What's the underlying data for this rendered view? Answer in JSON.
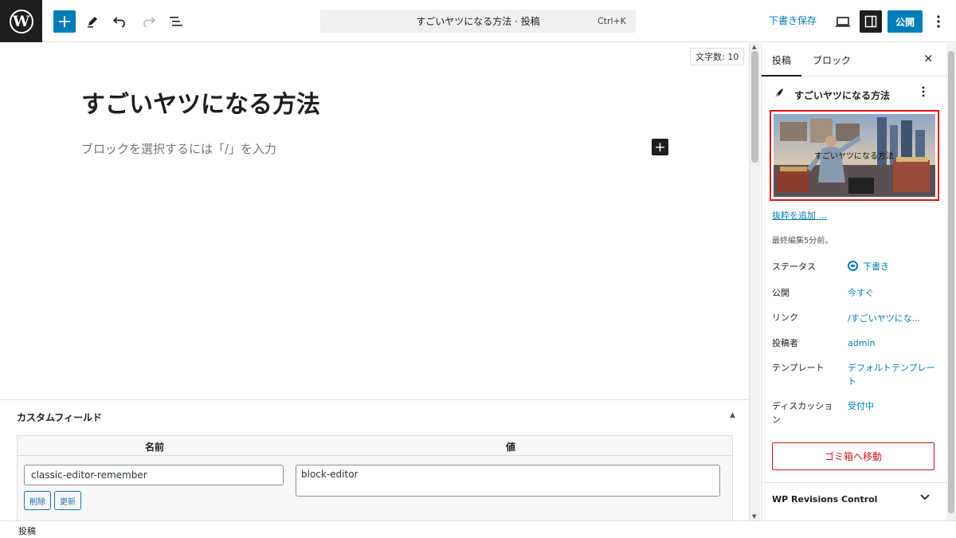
{
  "toolbar": {
    "logo_letter": "W",
    "inserter_icon": "+",
    "command_text": "すごいヤツになる方法 · 投稿",
    "command_shortcut": "Ctrl+K",
    "save_draft_label": "下書き保存",
    "publish_label": "公開"
  },
  "editor": {
    "word_count": "文字数: 10",
    "post_title": "すごいヤツになる方法",
    "block_placeholder": "ブロックを選択するには「/」を入力",
    "block_add_icon": "+"
  },
  "custom_fields": {
    "title": "カスタムフィールド",
    "col_name": "名前",
    "col_value": "値",
    "key": "classic-editor-remember",
    "value": "block-editor",
    "delete_label": "削除",
    "update_label": "更新"
  },
  "footer": {
    "breadcrumb": "投稿"
  },
  "sidebar": {
    "tab_post": "投稿",
    "tab_block": "ブロック",
    "close_icon": "×",
    "post_title": "すごいヤツになる方法",
    "image_overlay_text": "すごいヤツになる方法",
    "excerpt_link": "抜粋を追加 ...",
    "last_edited": "最終編集5分前。",
    "rows": [
      {
        "label": "ステータス",
        "value": "下書き"
      },
      {
        "label": "公開",
        "value": "今すぐ"
      },
      {
        "label": "リンク",
        "value": "/すごいヤツにな..."
      },
      {
        "label": "投稿者",
        "value": "admin"
      },
      {
        "label": "テンプレート",
        "value": "デフォルトテンプレート"
      },
      {
        "label": "ディスカッション",
        "value": "受付中"
      }
    ],
    "trash_label": "ゴミ箱へ移動",
    "revisions_title": "WP Revisions Control"
  },
  "colors": {
    "accent": "#007cba",
    "danger": "#cc1818",
    "dark": "#1e1e1e"
  }
}
